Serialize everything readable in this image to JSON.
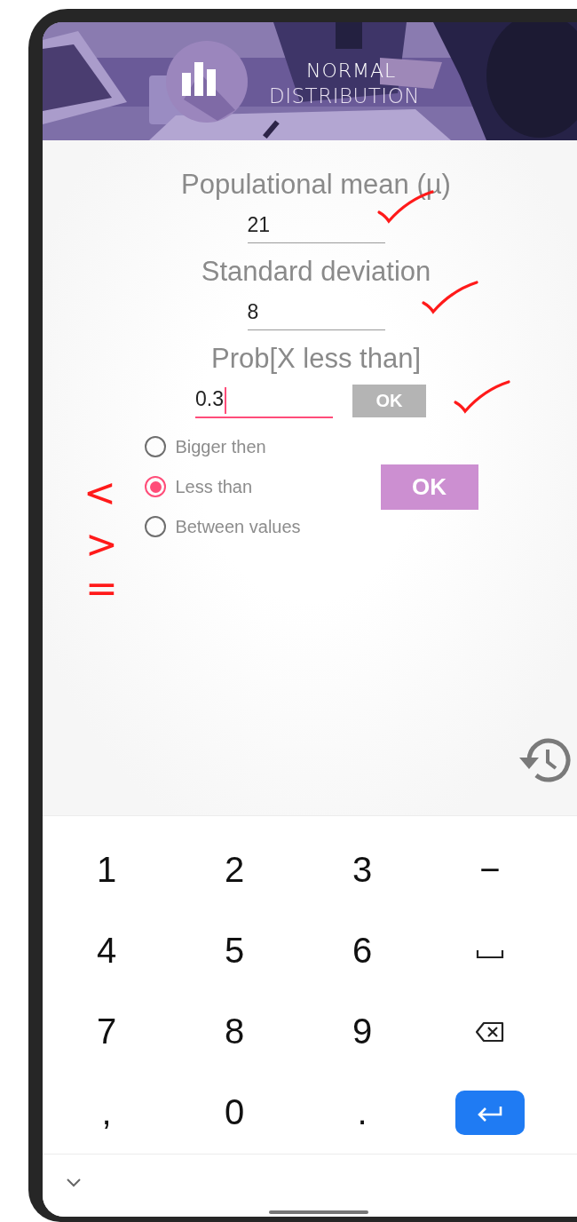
{
  "header": {
    "title_lines": [
      "NORMAL",
      "DISTRIBUTION"
    ]
  },
  "fields": [
    {
      "label": "Populational mean (µ)",
      "value": "21",
      "focused": false
    },
    {
      "label": "Standard deviation",
      "value": "8",
      "focused": false
    },
    {
      "label": "Prob[X less than]",
      "value": "0.3",
      "focused": true,
      "button": {
        "label": "OK",
        "disabled": true
      }
    }
  ],
  "options": [
    {
      "label": "Bigger then",
      "selected": false
    },
    {
      "label": "Less than",
      "selected": true
    },
    {
      "label": "Between values",
      "selected": false
    }
  ],
  "submit": {
    "label": "OK",
    "disabled": false
  },
  "keyboard": {
    "rows": [
      [
        {
          "kind": "char",
          "label": "1"
        },
        {
          "kind": "char",
          "label": "2"
        },
        {
          "kind": "char",
          "label": "3"
        },
        {
          "kind": "char",
          "label": "−"
        }
      ],
      [
        {
          "kind": "char",
          "label": "4"
        },
        {
          "kind": "char",
          "label": "5"
        },
        {
          "kind": "char",
          "label": "6"
        },
        {
          "kind": "space"
        }
      ],
      [
        {
          "kind": "char",
          "label": "7"
        },
        {
          "kind": "char",
          "label": "8"
        },
        {
          "kind": "char",
          "label": "9"
        },
        {
          "kind": "backspace"
        }
      ],
      [
        {
          "kind": "char",
          "label": ","
        },
        {
          "kind": "char",
          "label": "0"
        },
        {
          "kind": "char",
          "label": "."
        },
        {
          "kind": "enter"
        }
      ]
    ]
  },
  "annotations": [
    {
      "kind": "check"
    },
    {
      "kind": "check"
    },
    {
      "kind": "check"
    },
    {
      "kind": "symbol",
      "text": "<"
    },
    {
      "kind": "symbol",
      "text": ">"
    },
    {
      "kind": "symbol",
      "text": "="
    }
  ]
}
